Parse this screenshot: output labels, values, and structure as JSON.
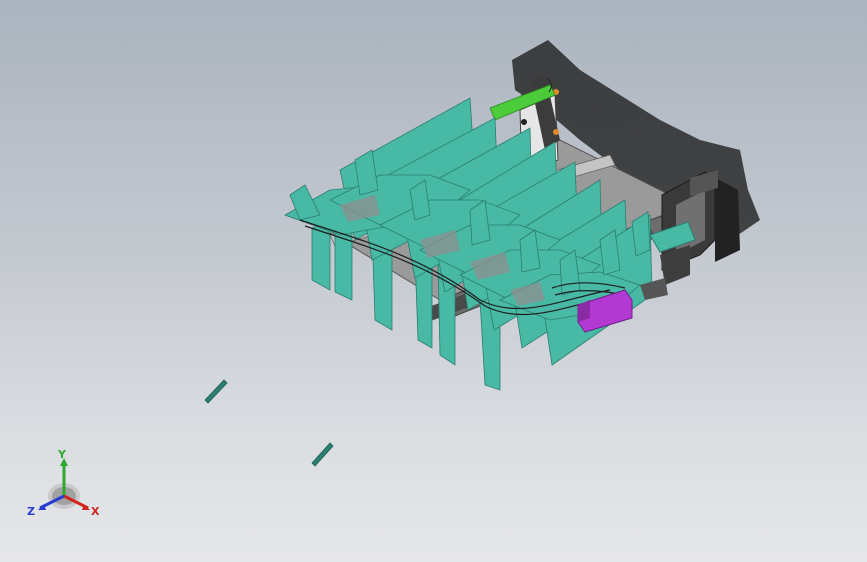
{
  "viewport": {
    "background_top": "#aab3be",
    "background_bottom": "#e6e7e9"
  },
  "model": {
    "fin_color": "#48b9a5",
    "fin_edge_color": "#2b7e70",
    "frame_color": "#8a8a8a",
    "accent_green": "#4ccc3a",
    "accent_magenta": "#b23ad2",
    "accent_orange": "#e08a2a",
    "bracket_color": "#2e2e2e"
  },
  "triad": {
    "x_label": "X",
    "y_label": "Y",
    "z_label": "Z",
    "x_color": "#d0261e",
    "y_color": "#2ea72e",
    "z_color": "#2a3bd1"
  }
}
